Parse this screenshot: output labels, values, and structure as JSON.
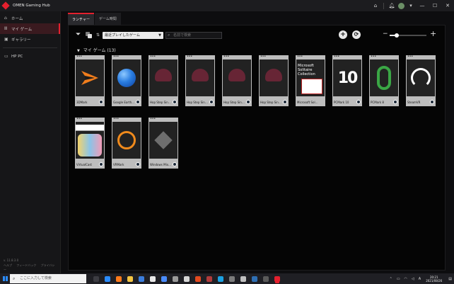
{
  "window": {
    "title": "OMEN Gaming Hub",
    "controls": {
      "minimize": "—",
      "maximize": "☐",
      "close": "✕"
    }
  },
  "sidebar": {
    "items": [
      {
        "label": "ホーム",
        "icon": "home-icon",
        "glyph": "⌂"
      },
      {
        "label": "マイ ゲーム",
        "icon": "library-icon",
        "glyph": "Ⅲ"
      },
      {
        "label": "ギャラリー",
        "icon": "image-icon",
        "glyph": "▣"
      },
      {
        "label": "HP PC",
        "icon": "monitor-icon",
        "glyph": "▭"
      }
    ],
    "version": "v. 11.8.3.0",
    "links": [
      "ヘルプ",
      "フィードバック",
      "プライバシー"
    ]
  },
  "tabs": [
    {
      "label": "ランチャー"
    },
    {
      "label": "ゲーム時間"
    }
  ],
  "toolbar": {
    "sort_value": "最近プレイしたゲーム",
    "search_placeholder": "名前で検索",
    "add_button": "+",
    "refresh_button": "⟳",
    "zoom_level": 0.2
  },
  "section": {
    "title": "マイ ゲーム",
    "count": "(13)"
  },
  "games": [
    {
      "name": "3DMark"
    },
    {
      "name": "Google Earth..."
    },
    {
      "name": "Hop Step Sing..."
    },
    {
      "name": "Hop Step Sing..."
    },
    {
      "name": "Hop Step Sing..."
    },
    {
      "name": "Hop Step Sing..."
    },
    {
      "name": "Microsoft Solit..."
    },
    {
      "name": "PCMark 10"
    },
    {
      "name": "PCMark 8"
    },
    {
      "name": "SteamVR"
    },
    {
      "name": "VirtualCast"
    },
    {
      "name": "VRMark"
    },
    {
      "name": "Windows Mixe..."
    }
  ],
  "art_text": {
    "solitaire": "Microsoft Solitaire Collection",
    "pcmark10": "10",
    "pcmark10_color": "#c31b27"
  },
  "taskbar": {
    "search_placeholder": "ここに入力して検索",
    "time": "20:21",
    "date": "2021/08/26",
    "ime": "A"
  },
  "colors": {
    "accent": "#e4202e"
  }
}
